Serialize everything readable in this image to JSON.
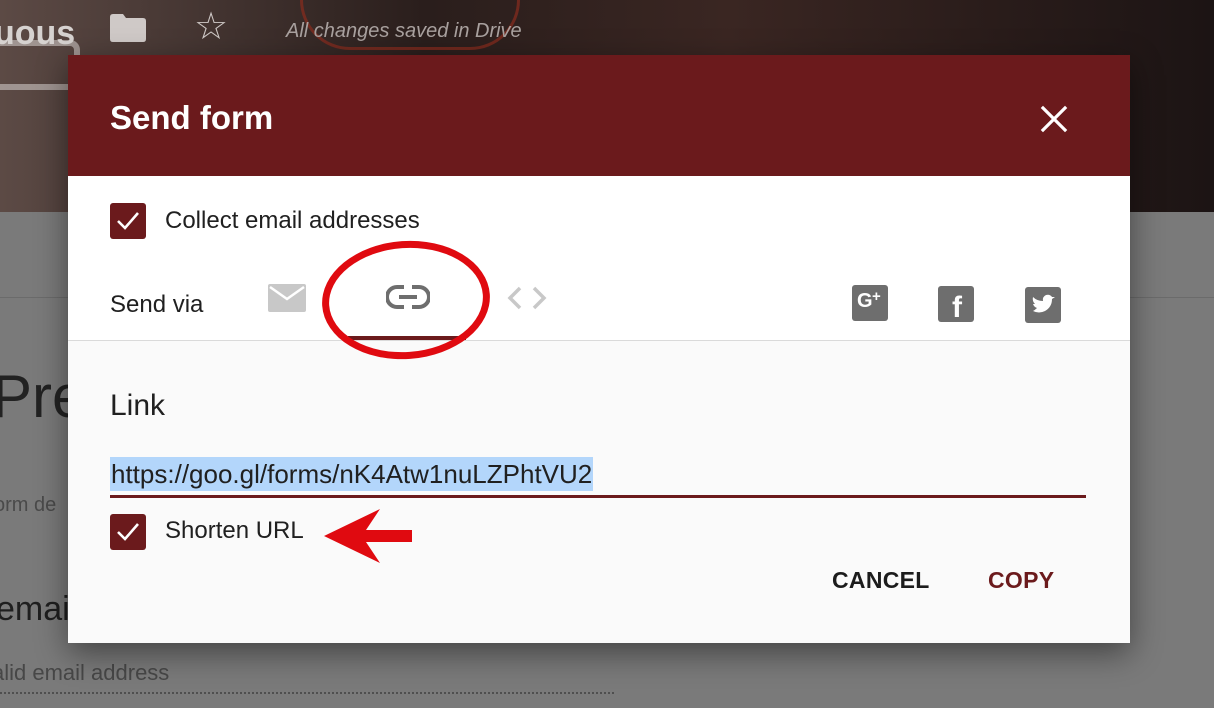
{
  "background": {
    "app_name": "uous",
    "saved_status": "All changes saved in Drive",
    "form_title": "Pre",
    "form_description": "orm de",
    "question_title": "email",
    "question_hint": "alid email address"
  },
  "dialog": {
    "title": "Send form",
    "collect_email_label": "Collect email addresses",
    "collect_email_checked": true,
    "send_via_label": "Send via",
    "send_via_options": [
      "email-icon",
      "link-icon",
      "embed-icon"
    ],
    "active_send_via": "link-icon",
    "social_options": [
      "google-plus-icon",
      "facebook-icon",
      "twitter-icon"
    ],
    "link_section_label": "Link",
    "link_url": "https://goo.gl/forms/nK4Atw1nuLZPhtVU2",
    "shorten_url_label": "Shorten URL",
    "shorten_url_checked": true,
    "cancel_label": "CANCEL",
    "copy_label": "COPY"
  },
  "colors": {
    "accent": "#6b1a1c",
    "annotation_red": "#e00a10",
    "selection": "#b3d6fb"
  }
}
